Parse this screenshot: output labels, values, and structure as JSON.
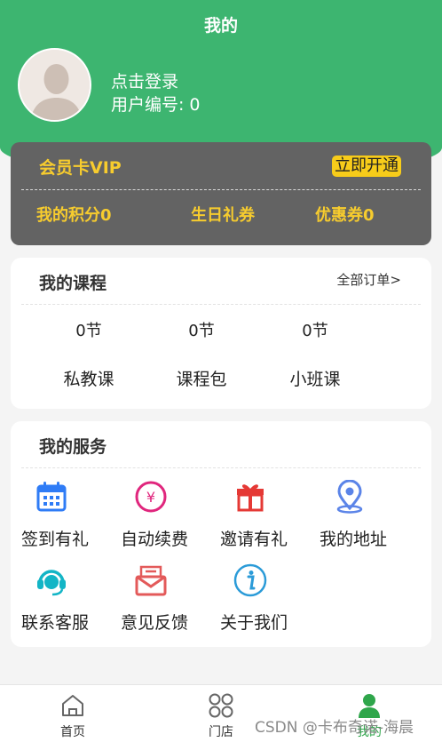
{
  "header": {
    "title": "我的"
  },
  "user": {
    "login_text": "点击登录",
    "id_label": "用户编号:",
    "id_value": "0"
  },
  "vip": {
    "title": "会员卡VIP",
    "action": "立即开通",
    "stats": [
      "我的积分0",
      "生日礼券",
      "优惠券0"
    ]
  },
  "courses": {
    "title": "我的课程",
    "link": "全部订单>",
    "items": [
      {
        "count": "0节",
        "label": "私教课"
      },
      {
        "count": "0节",
        "label": "课程包"
      },
      {
        "count": "0节",
        "label": "小班课"
      }
    ]
  },
  "services": {
    "title": "我的服务",
    "items": [
      {
        "label": "签到有礼",
        "icon": "calendar-icon",
        "color": "#2f7cf6"
      },
      {
        "label": "自动续费",
        "icon": "yen-icon",
        "color": "#e0267d"
      },
      {
        "label": "邀请有礼",
        "icon": "gift-icon",
        "color": "#e53935"
      },
      {
        "label": "我的地址",
        "icon": "location-pin-icon",
        "color": "#5b84e8"
      },
      {
        "label": "联系客服",
        "icon": "headset-icon",
        "color": "#13b5c6"
      },
      {
        "label": "意见反馈",
        "icon": "envelope-icon",
        "color": "#e35a5a"
      },
      {
        "label": "关于我们",
        "icon": "info-icon",
        "color": "#2b9bd8"
      }
    ]
  },
  "tabbar": {
    "items": [
      {
        "label": "首页",
        "icon": "home-icon"
      },
      {
        "label": "门店",
        "icon": "grid-icon"
      },
      {
        "label": "我的",
        "icon": "user-icon",
        "active": true
      }
    ],
    "active_color": "#2fa64b"
  },
  "watermark": "CSDN @卡布奇诺-海晨",
  "colors": {
    "brand": "#3db570",
    "vip_bg": "#636363",
    "vip_gold": "#f7cc2e"
  }
}
